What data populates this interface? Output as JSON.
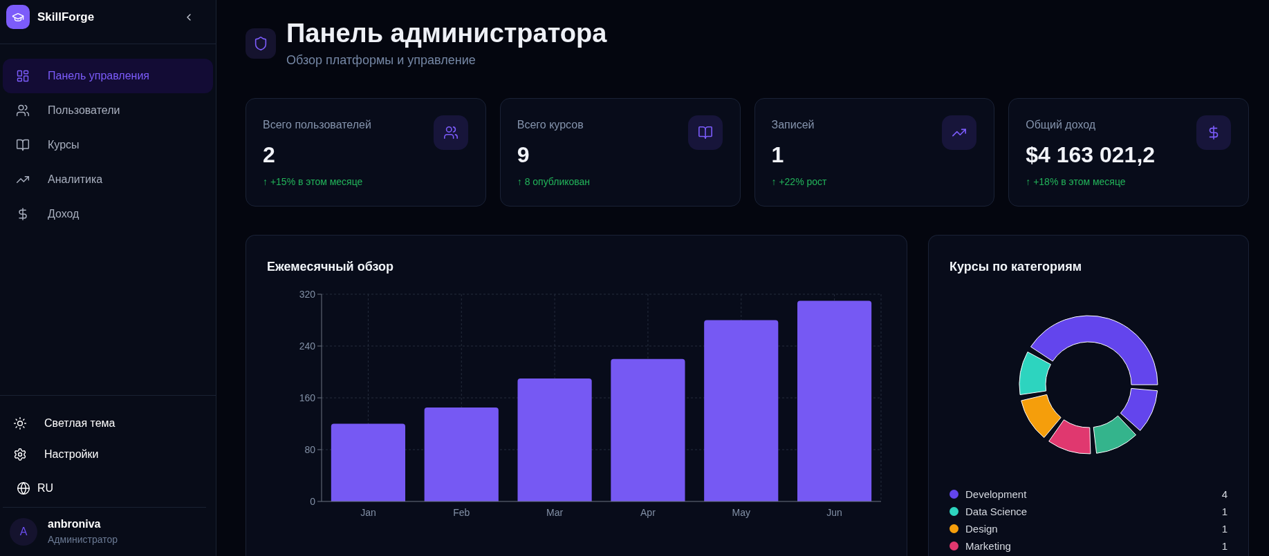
{
  "sidebar": {
    "brand": "SkillForge",
    "nav": [
      {
        "label": "Панель управления",
        "selected": true
      },
      {
        "label": "Пользователи",
        "selected": false
      },
      {
        "label": "Курсы",
        "selected": false
      },
      {
        "label": "Аналитика",
        "selected": false
      },
      {
        "label": "Доход",
        "selected": false
      }
    ],
    "footer": {
      "theme_toggle": "Светлая тема",
      "settings": "Настройки",
      "language": "RU"
    },
    "user": {
      "avatar_initial": "A",
      "name": "anbroniva",
      "role": "Администратор"
    }
  },
  "header": {
    "title": "Панель администратора",
    "subtitle": "Обзор платформы и управление"
  },
  "stats": [
    {
      "label": "Всего пользователей",
      "value": "2",
      "trend": "↑ +15% в этом месяце"
    },
    {
      "label": "Всего курсов",
      "value": "9",
      "trend": "↑ 8 опубликован"
    },
    {
      "label": "Записей",
      "value": "1",
      "trend": "↑ +22% рост"
    },
    {
      "label": "Общий доход",
      "value": "$4 163 021,2",
      "trend": "↑ +18% в этом месяце"
    }
  ],
  "monthly_overview": {
    "title": "Ежемесячный обзор",
    "chart_data": {
      "type": "bar",
      "categories": [
        "Jan",
        "Feb",
        "Mar",
        "Apr",
        "May",
        "Jun"
      ],
      "values": [
        120,
        145,
        190,
        220,
        280,
        310
      ],
      "ylim": [
        0,
        320
      ],
      "yticks": [
        0,
        80,
        160,
        240,
        320
      ],
      "grid": true
    }
  },
  "categories_card": {
    "title": "Курсы по категориям",
    "chart_data": {
      "type": "donut",
      "categories": [
        "Development",
        "Data Science",
        "Design",
        "Marketing",
        null,
        null
      ],
      "values": [
        4,
        1,
        1,
        1,
        1,
        1
      ],
      "value_labels": [
        "4",
        "1",
        "1",
        "1",
        null,
        null
      ],
      "colors": [
        "#6345ed",
        "#2dd4bf",
        "#f59e0b",
        "#e0386f",
        "#34b48c",
        "#6345ed"
      ],
      "legend": "bottom"
    }
  }
}
